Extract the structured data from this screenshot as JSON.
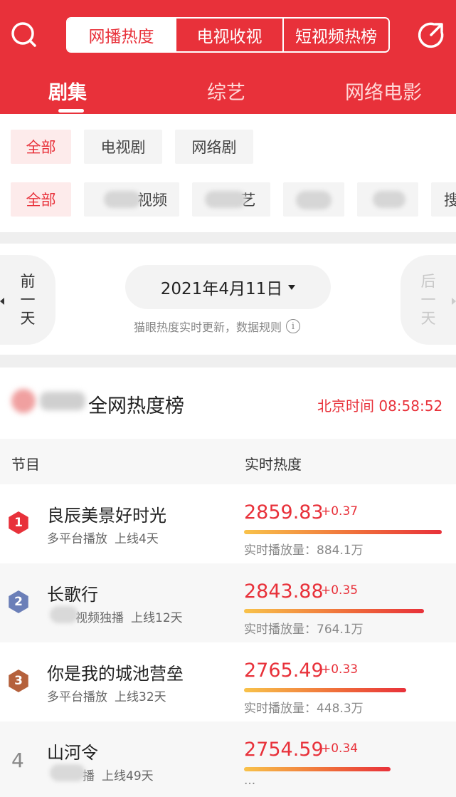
{
  "header": {
    "segments": [
      "网播热度",
      "电视收视",
      "短视频热榜"
    ],
    "active_segment": 0,
    "categories": [
      "剧集",
      "综艺",
      "网络电影"
    ],
    "active_category": 0
  },
  "filters": {
    "types": [
      "全部",
      "电视剧",
      "网络剧"
    ],
    "platforms": [
      "全部",
      "视频",
      "艺",
      "",
      "",
      "搜"
    ]
  },
  "date": {
    "prev_label": [
      "前",
      "一",
      "天"
    ],
    "next_label": [
      "后",
      "一",
      "天"
    ],
    "current": "2021年4月11日",
    "note": "猫眼热度实时更新，数据规则",
    "info_glyph": "i"
  },
  "ranking": {
    "title": "全网热度榜",
    "clock": "北京时间 08:58:52",
    "col_program": "节目",
    "col_heat": "实时热度",
    "rows": [
      {
        "rank": "1",
        "name": "良辰美景好时光",
        "platform": "多平台播放",
        "days": "上线4天",
        "heat": "2859.83",
        "delta": "+0.37",
        "plays": "实时播放量：884.1万",
        "heat_fraction": 1.0
      },
      {
        "rank": "2",
        "name": "长歌行",
        "platform": "视频独播",
        "days": "上线12天",
        "heat": "2843.88",
        "delta": "+0.35",
        "plays": "实时播放量：764.1万",
        "heat_fraction": 0.91
      },
      {
        "rank": "3",
        "name": "你是我的城池营垒",
        "platform": "多平台播放",
        "days": "上线32天",
        "heat": "2765.49",
        "delta": "+0.33",
        "plays": "实时播放量：448.3万",
        "heat_fraction": 0.82
      },
      {
        "rank": "4",
        "name": "山河令",
        "platform": "播",
        "days": "上线49天",
        "heat": "2754.59",
        "delta": "+0.34",
        "plays": "···",
        "heat_fraction": 0.74
      }
    ]
  },
  "colors": {
    "brand_red": "#e8313a",
    "rank1": "#e8313a",
    "rank2": "#6b7fb8",
    "rank3": "#b5613c"
  },
  "icons": [
    "search-icon",
    "share-icon",
    "caret-down-icon",
    "info-icon",
    "chevron-left-icon",
    "chevron-right-icon"
  ]
}
